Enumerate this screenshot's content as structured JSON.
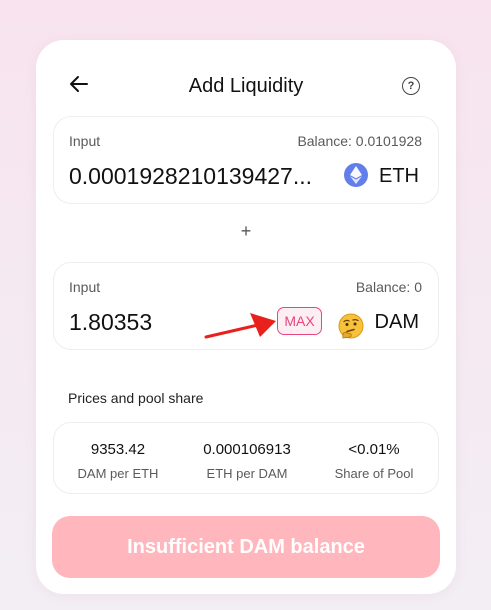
{
  "header": {
    "title": "Add Liquidity",
    "help_glyph": "?"
  },
  "input_a": {
    "label": "Input",
    "balance": "Balance: 0.0101928",
    "amount": "0.0001928210139427...",
    "token": "ETH"
  },
  "plus": "+",
  "input_b": {
    "label": "Input",
    "balance": "Balance: 0",
    "amount": "1.80353",
    "max_label": "MAX",
    "token": "DAM"
  },
  "prices": {
    "title": "Prices and pool share",
    "items": [
      {
        "value": "9353.42",
        "label": "DAM per ETH"
      },
      {
        "value": "0.000106913",
        "label": "ETH per DAM"
      },
      {
        "value": "<0.01%",
        "label": "Share of Pool"
      }
    ]
  },
  "action_button": {
    "label": "Insufficient DAM balance"
  },
  "colors": {
    "accent": "#e8467f",
    "button_bg": "#ffb6bd",
    "eth_icon": "#627eea",
    "annotation_arrow": "#e8211d"
  },
  "icons": [
    "back-arrow-icon",
    "help-icon",
    "eth-icon",
    "thinking-face-icon",
    "annotation-arrow-icon"
  ]
}
